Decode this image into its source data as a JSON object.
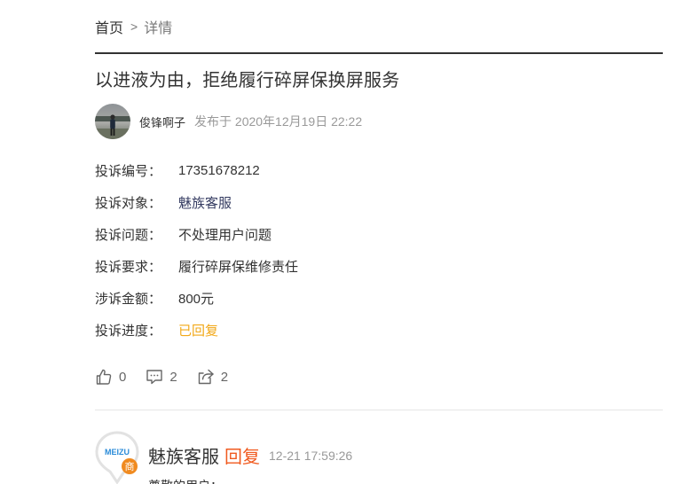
{
  "breadcrumb": {
    "home": "首页",
    "separator": ">",
    "current": "详情"
  },
  "title": "以进液为由，拒绝履行碎屏保换屏服务",
  "author": {
    "name": "俊锋啊子",
    "published": "发布于 2020年12月19日 22:22",
    "avatar_icon": "user-avatar-photo"
  },
  "complaint": {
    "rows": [
      {
        "label": "投诉编号：",
        "value": "17351678212"
      },
      {
        "label": "投诉对象：",
        "value": "魅族客服"
      },
      {
        "label": "投诉问题：",
        "value": "不处理用户问题"
      },
      {
        "label": "投诉要求：",
        "value": "履行碎屏保维修责任"
      },
      {
        "label": "涉诉金额：",
        "value": "800元"
      },
      {
        "label": "投诉进度：",
        "value": "已回复"
      }
    ]
  },
  "actions": {
    "likes": "0",
    "comments": "2",
    "shares": "2"
  },
  "reply": {
    "name": "魅族客服",
    "tag": "回复",
    "time": "12-21 17:59:26",
    "logo_text": "MEIZU",
    "badge_text": "商",
    "body": "尊敬的用户："
  },
  "colors": {
    "status": "#f2a818",
    "link": "#333a60",
    "reply_tag": "#f05a1f",
    "badge": "#f08a1f",
    "logo_blue": "#2a8bd8"
  }
}
